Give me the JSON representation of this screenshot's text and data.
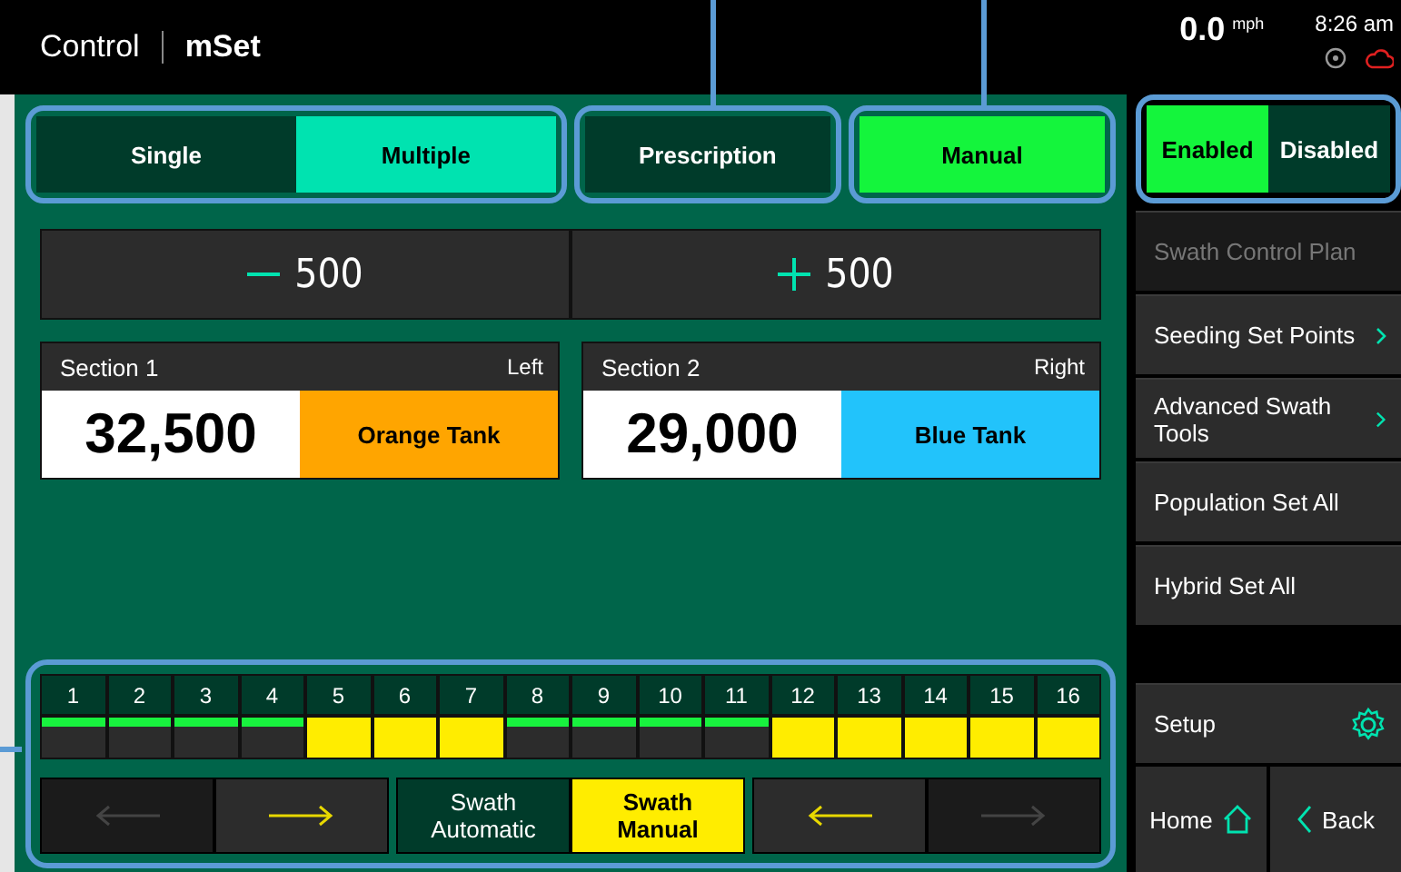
{
  "header": {
    "title": "Control",
    "subtitle": "mSet",
    "speed": "0.0",
    "speed_unit": "mph",
    "time": "8:26 am"
  },
  "mode_toggle": [
    {
      "label": "Single",
      "selected": false
    },
    {
      "label": "Multiple",
      "selected": true
    }
  ],
  "rate_toggle": [
    {
      "label": "Prescription",
      "selected": false
    },
    {
      "label": "Manual",
      "selected": true
    }
  ],
  "enable_toggle": [
    {
      "label": "Enabled",
      "selected": true
    },
    {
      "label": "Disabled",
      "selected": false
    }
  ],
  "steppers": [
    {
      "kind": "minus",
      "label": "500"
    },
    {
      "kind": "plus",
      "label": "500"
    }
  ],
  "sections": [
    {
      "name": "Section 1",
      "side": "Left",
      "value": "32,500",
      "tank": "Orange Tank",
      "color": "#ffa500"
    },
    {
      "name": "Section 2",
      "side": "Right",
      "value": "29,000",
      "tank": "Blue Tank",
      "color": "#22c3fb"
    }
  ],
  "swath_sections": [
    {
      "label": "1",
      "on": true
    },
    {
      "label": "2",
      "on": true
    },
    {
      "label": "3",
      "on": true
    },
    {
      "label": "4",
      "on": true
    },
    {
      "label": "5",
      "on": false
    },
    {
      "label": "6",
      "on": false
    },
    {
      "label": "7",
      "on": false
    },
    {
      "label": "8",
      "on": true
    },
    {
      "label": "9",
      "on": true
    },
    {
      "label": "10",
      "on": true
    },
    {
      "label": "11",
      "on": true
    },
    {
      "label": "12",
      "on": false
    },
    {
      "label": "13",
      "on": false
    },
    {
      "label": "14",
      "on": false
    },
    {
      "label": "15",
      "on": false
    },
    {
      "label": "16",
      "on": false
    }
  ],
  "left_arrows": [
    {
      "kind": "left",
      "disabled": true
    },
    {
      "kind": "right",
      "disabled": false
    }
  ],
  "swath_mode": [
    {
      "label": "Swath Automatic",
      "selected": false
    },
    {
      "label": "Swath Manual",
      "selected": true
    }
  ],
  "right_arrows": [
    {
      "kind": "left",
      "disabled": false
    },
    {
      "kind": "right",
      "disabled": true
    }
  ],
  "menu": [
    {
      "label": "Swath Control Plan",
      "disabled": true,
      "chevron": false
    },
    {
      "label": "Seeding Set Points",
      "disabled": false,
      "chevron": true
    },
    {
      "label": "Advanced Swath Tools",
      "disabled": false,
      "chevron": true
    },
    {
      "label": "Population Set All",
      "disabled": false,
      "chevron": false
    },
    {
      "label": "Hybrid Set All",
      "disabled": false,
      "chevron": false
    }
  ],
  "setup": "Setup",
  "home": "Home",
  "back": "Back"
}
